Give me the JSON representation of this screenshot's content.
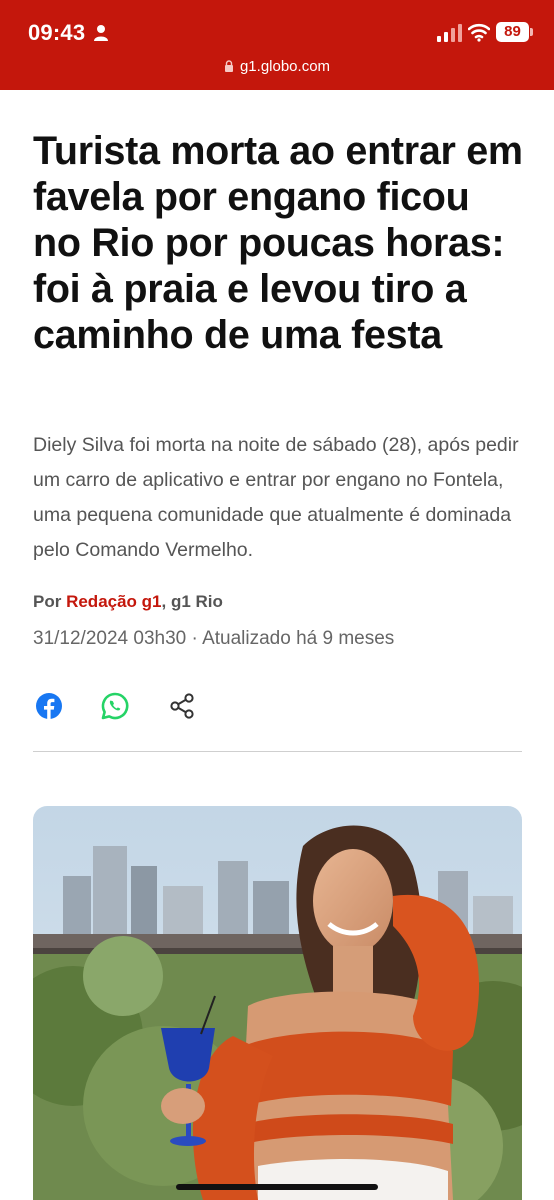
{
  "status_bar": {
    "time": "09:43",
    "battery": "89"
  },
  "browser": {
    "url": "g1.globo.com"
  },
  "article": {
    "headline": "Turista morta ao entrar em favela por engano ficou no Rio por poucas horas: foi à praia e levou tiro a caminho de uma festa",
    "subtitle": "Diely Silva foi morta na noite de sábado (28), após pedir um carro de aplicativo e entrar por engano no Fontela, uma pequena comunidade que atualmente é dominada pelo Comando Vermelho.",
    "byline_prefix": "Por",
    "author": "Redação g1",
    "byline_suffix": ", g1 Rio",
    "date": "31/12/2024 03h30",
    "separator": " · ",
    "updated": "Atualizado há 9 meses"
  },
  "share": {
    "icons": [
      "facebook-icon",
      "whatsapp-icon",
      "share-icon"
    ]
  },
  "colors": {
    "brand_red": "#c4170c",
    "facebook_blue": "#1877f2",
    "whatsapp_green": "#25d366",
    "headline_text": "#111111",
    "body_text": "#555555"
  }
}
